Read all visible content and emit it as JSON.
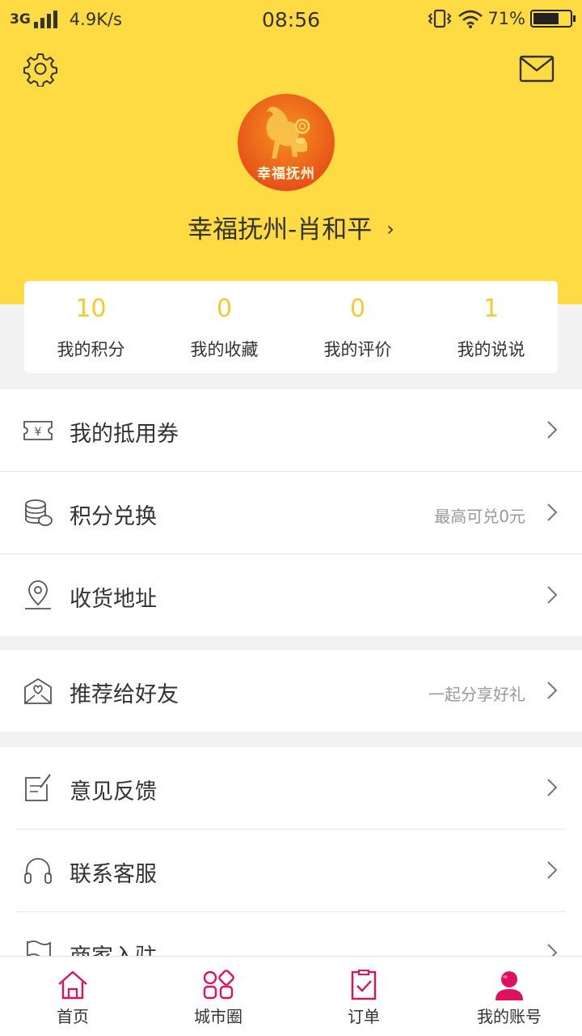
{
  "status_bar": {
    "network": "3G",
    "speed": "4.9K/s",
    "time": "08:56",
    "battery": "71%",
    "battery_level": 0.71
  },
  "header": {
    "avatar_text": "幸福抚州",
    "username": "幸福抚州-肖和平",
    "chevron": "›",
    "bg_color": "#fedb43"
  },
  "stats": [
    {
      "value": "10",
      "label": "我的积分"
    },
    {
      "value": "0",
      "label": "我的收藏"
    },
    {
      "value": "0",
      "label": "我的评价"
    },
    {
      "value": "1",
      "label": "我的说说"
    }
  ],
  "menu": {
    "coupons": {
      "label": "我的抵用券",
      "icon": "coupon-icon"
    },
    "points": {
      "label": "积分兑换",
      "hint": "最高可兑0元",
      "icon": "coins-icon"
    },
    "address": {
      "label": "收货地址",
      "icon": "location-pin-icon"
    },
    "recommend": {
      "label": "推荐给好友",
      "hint": "一起分享好礼",
      "icon": "heart-envelope-icon"
    },
    "feedback": {
      "label": "意见反馈",
      "icon": "edit-note-icon"
    },
    "support": {
      "label": "联系客服",
      "icon": "headphones-icon"
    },
    "merchant": {
      "label": "商家入驻",
      "icon": "flag-icon"
    }
  },
  "tabs": [
    {
      "label": "首页",
      "icon": "home-icon"
    },
    {
      "label": "城市圈",
      "icon": "grid-apps-icon"
    },
    {
      "label": "订单",
      "icon": "clipboard-check-icon"
    },
    {
      "label": "我的账号",
      "icon": "user-icon"
    }
  ],
  "colors": {
    "accent_yellow": "#fedb43",
    "stat_number": "#f2cc2a",
    "tab_icon": "#e0105e"
  }
}
